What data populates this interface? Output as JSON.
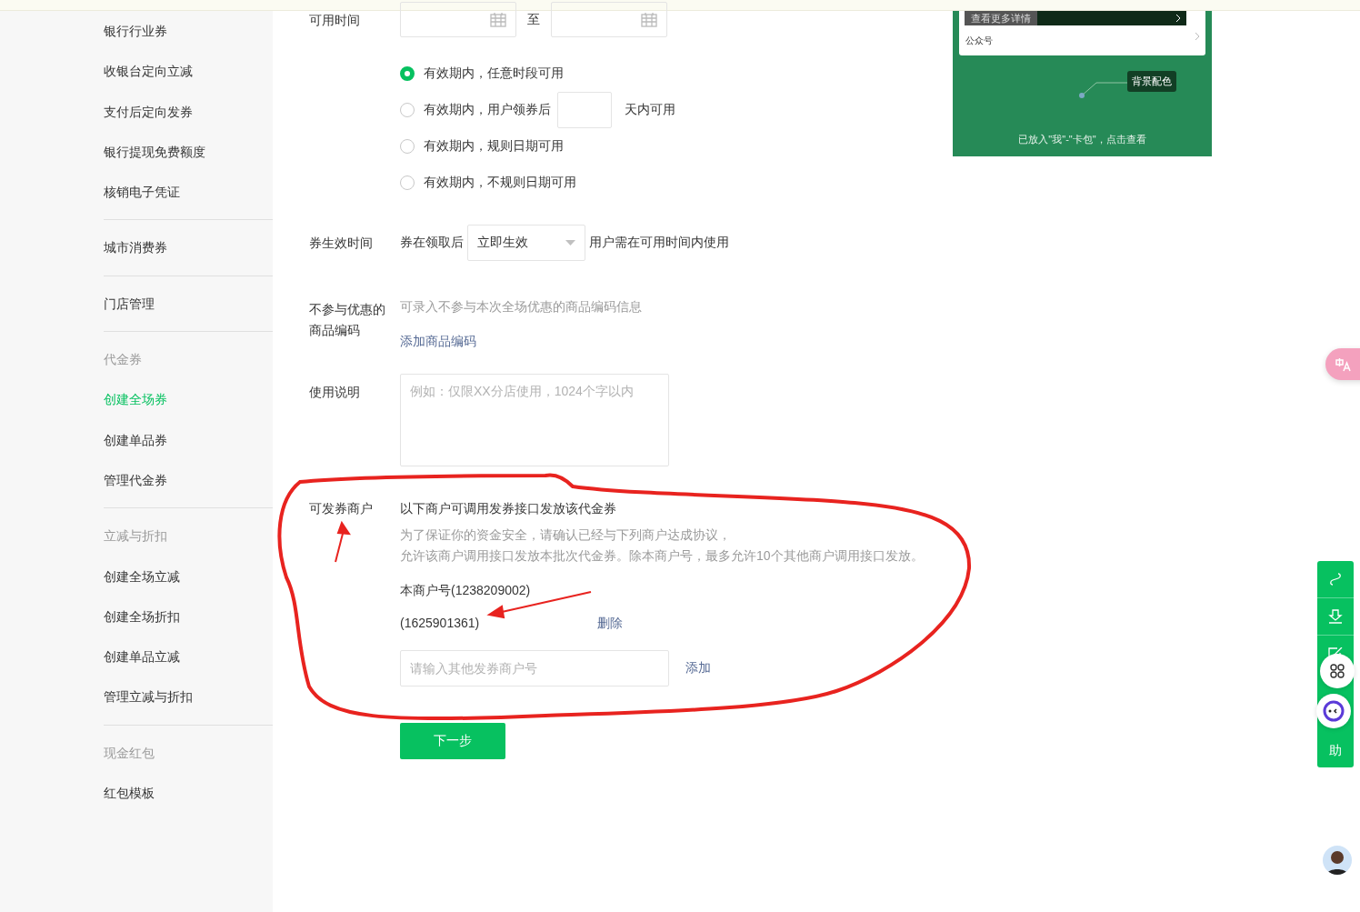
{
  "sidebar": {
    "groups": [
      {
        "items": [
          {
            "label": "银行行业券",
            "kind": "link",
            "selected": false
          },
          {
            "label": "收银台定向立减",
            "kind": "link",
            "selected": false
          },
          {
            "label": "支付后定向发券",
            "kind": "link",
            "selected": false
          },
          {
            "label": "银行提现免费额度",
            "kind": "link",
            "selected": false
          },
          {
            "label": "核销电子凭证",
            "kind": "link",
            "selected": false
          }
        ]
      },
      {
        "items": [
          {
            "label": "城市消费券",
            "kind": "link",
            "selected": false
          }
        ]
      },
      {
        "items": [
          {
            "label": "门店管理",
            "kind": "link",
            "selected": false
          }
        ]
      },
      {
        "items": [
          {
            "label": "代金券",
            "kind": "header"
          },
          {
            "label": "创建全场券",
            "kind": "link",
            "selected": true
          },
          {
            "label": "创建单品券",
            "kind": "link",
            "selected": false
          },
          {
            "label": "管理代金券",
            "kind": "link",
            "selected": false
          }
        ]
      },
      {
        "items": [
          {
            "label": "立减与折扣",
            "kind": "header"
          },
          {
            "label": "创建全场立减",
            "kind": "link",
            "selected": false
          },
          {
            "label": "创建全场折扣",
            "kind": "link",
            "selected": false
          },
          {
            "label": "创建单品立减",
            "kind": "link",
            "selected": false
          },
          {
            "label": "管理立减与折扣",
            "kind": "link",
            "selected": false
          }
        ]
      },
      {
        "items": [
          {
            "label": "现金红包",
            "kind": "header"
          },
          {
            "label": "红包模板",
            "kind": "link",
            "selected": false
          }
        ]
      }
    ]
  },
  "form": {
    "available_time": {
      "label": "可用时间",
      "separator": "至",
      "options": [
        {
          "label": "有效期内，任意时段可用",
          "kind": "plain",
          "selected": true
        },
        {
          "label": "有效期内，用户领券后",
          "kind": "days",
          "suffix": "天内可用",
          "selected": false
        },
        {
          "label": "有效期内，规则日期可用",
          "kind": "plain",
          "selected": false
        },
        {
          "label": "有效期内，不规则日期可用",
          "kind": "plain",
          "selected": false
        }
      ]
    },
    "effective_time": {
      "label": "券生效时间",
      "prefix": "券在领取后",
      "value": "立即生效",
      "suffix": "用户需在可用时间内使用"
    },
    "excluded_codes": {
      "label": "不参与优惠的商品编码",
      "hint": "可录入不参与本次全场优惠的商品编码信息",
      "link": "添加商品编码"
    },
    "usage_notes": {
      "label": "使用说明",
      "placeholder": "例如：仅限XX分店使用，1024个字以内"
    },
    "merchants": {
      "label": "可发券商户",
      "title": "以下商户可调用发券接口发放该代金券",
      "notes": [
        "为了保证你的资金安全，请确认已经与下列商户达成协议，",
        "允许该商户调用接口发放本批次代金券。除本商户号，最多允许10个其他商户调用接口发放。"
      ],
      "own": "本商户号(1238209002)",
      "others": [
        {
          "id": "(1625901361)",
          "action": "删除"
        }
      ],
      "placeholder": "请输入其他发券商户号",
      "add": "添加"
    },
    "next": "下一步"
  },
  "preview": {
    "more": "查看更多详情",
    "account": "公众号",
    "tooltip": "背景配色",
    "footer": "已放入\"我\"-\"卡包\"，点击查看"
  },
  "help": {
    "label": "助"
  }
}
